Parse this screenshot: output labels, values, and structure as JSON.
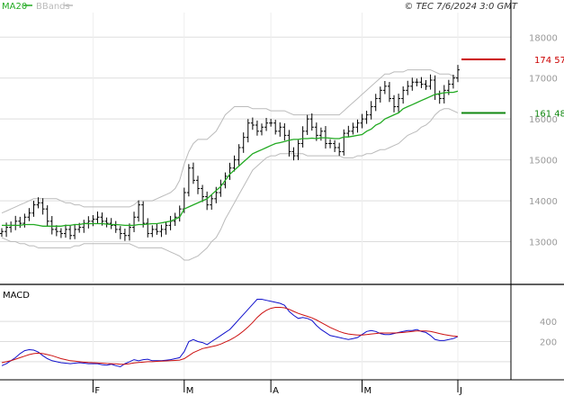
{
  "header": {
    "legend": [
      {
        "name": "MA20",
        "color": "#22aa22"
      },
      {
        "name": "BBands",
        "color": "#bbbbbb"
      }
    ],
    "source": "© TEC 7/6/2024 3:0 GMT"
  },
  "colors": {
    "candle": "#000000",
    "ma20": "#22aa22",
    "bbands": "#bbbbbb",
    "resistance": "#cc0000",
    "support": "#118811",
    "macd": "#1111cc",
    "signal": "#cc1111",
    "grid": "#dddddd",
    "axis_text": "#999999"
  },
  "chart_data": [
    {
      "type": "candlestick",
      "title": "",
      "ylim": [
        12000,
        18600
      ],
      "yticks": [
        {
          "value": 13000,
          "label": "13000"
        },
        {
          "value": 14000,
          "label": "14000"
        },
        {
          "value": 15000,
          "label": "15000"
        },
        {
          "value": 16000,
          "label": "16000"
        },
        {
          "value": 17000,
          "label": "17000"
        },
        {
          "value": 18000,
          "label": "18000"
        }
      ],
      "levels": [
        {
          "name": "resistance",
          "value": 17457,
          "label": "174 57",
          "color": "#cc0000"
        },
        {
          "name": "support",
          "value": 16148,
          "label": "161 48",
          "color": "#118811"
        }
      ],
      "x_months": [
        {
          "label": "F",
          "index": 20
        },
        {
          "label": "M",
          "index": 40
        },
        {
          "label": "A",
          "index": 59
        },
        {
          "label": "M",
          "index": 79
        },
        {
          "label": "J",
          "index": 100
        }
      ],
      "close": [
        13250,
        13350,
        13400,
        13500,
        13450,
        13600,
        13700,
        13900,
        13950,
        13800,
        13500,
        13300,
        13250,
        13200,
        13300,
        13150,
        13300,
        13350,
        13450,
        13500,
        13550,
        13600,
        13500,
        13450,
        13400,
        13300,
        13200,
        13150,
        13350,
        13600,
        13900,
        13450,
        13200,
        13300,
        13250,
        13300,
        13400,
        13500,
        13600,
        13800,
        14200,
        14800,
        14500,
        14300,
        14100,
        13900,
        14050,
        14200,
        14400,
        14600,
        14800,
        15000,
        15300,
        15550,
        15900,
        15850,
        15700,
        15800,
        15900,
        15900,
        15700,
        15800,
        15600,
        15200,
        15100,
        15400,
        15700,
        16000,
        15800,
        15600,
        15700,
        15400,
        15400,
        15300,
        15200,
        15650,
        15700,
        15800,
        15900,
        16000,
        16100,
        16300,
        16500,
        16700,
        16800,
        16500,
        16300,
        16500,
        16700,
        16800,
        16900,
        16900,
        16850,
        16800,
        16950,
        16600,
        16500,
        16700,
        16850,
        17000,
        17200
      ],
      "ma20": [
        13400,
        13400,
        13400,
        13400,
        13400,
        13420,
        13420,
        13420,
        13400,
        13380,
        13380,
        13380,
        13380,
        13380,
        13400,
        13400,
        13420,
        13420,
        13440,
        13440,
        13440,
        13440,
        13440,
        13430,
        13420,
        13420,
        13410,
        13400,
        13400,
        13400,
        13420,
        13420,
        13430,
        13440,
        13440,
        13460,
        13480,
        13500,
        13550,
        13600,
        13800,
        13850,
        13900,
        13950,
        14000,
        14050,
        14150,
        14250,
        14350,
        14500,
        14650,
        14750,
        14850,
        14950,
        15050,
        15150,
        15200,
        15250,
        15300,
        15350,
        15400,
        15420,
        15450,
        15480,
        15500,
        15500,
        15520,
        15520,
        15530,
        15520,
        15540,
        15540,
        15530,
        15520,
        15520,
        15560,
        15560,
        15580,
        15600,
        15620,
        15700,
        15750,
        15850,
        15900,
        16000,
        16050,
        16100,
        16150,
        16250,
        16300,
        16350,
        16400,
        16450,
        16500,
        16550,
        16600,
        16620,
        16640,
        16650,
        16650,
        16680
      ],
      "bb_upper": [
        13700,
        13750,
        13800,
        13850,
        13900,
        13950,
        14000,
        14050,
        14050,
        14050,
        14050,
        14050,
        14050,
        14000,
        13950,
        13950,
        13900,
        13900,
        13850,
        13850,
        13850,
        13850,
        13850,
        13850,
        13850,
        13850,
        13850,
        13850,
        13850,
        13900,
        14000,
        14000,
        14000,
        14000,
        14050,
        14100,
        14150,
        14200,
        14300,
        14500,
        14900,
        15200,
        15400,
        15500,
        15500,
        15500,
        15600,
        15700,
        15900,
        16100,
        16200,
        16300,
        16300,
        16300,
        16300,
        16250,
        16250,
        16250,
        16250,
        16200,
        16200,
        16200,
        16200,
        16150,
        16100,
        16100,
        16100,
        16100,
        16100,
        16100,
        16100,
        16100,
        16100,
        16100,
        16100,
        16200,
        16300,
        16400,
        16500,
        16600,
        16700,
        16800,
        16900,
        17000,
        17100,
        17100,
        17150,
        17150,
        17150,
        17200,
        17200,
        17200,
        17200,
        17200,
        17200,
        17150,
        17100,
        17100,
        17100,
        17050,
        17000
      ],
      "bb_lower": [
        13100,
        13050,
        13000,
        13000,
        12950,
        12950,
        12900,
        12900,
        12850,
        12850,
        12850,
        12850,
        12850,
        12850,
        12850,
        12850,
        12900,
        12900,
        12950,
        12950,
        12950,
        12950,
        12950,
        12950,
        12950,
        12950,
        12950,
        12950,
        12950,
        12900,
        12850,
        12850,
        12850,
        12850,
        12850,
        12850,
        12800,
        12750,
        12700,
        12650,
        12550,
        12550,
        12600,
        12650,
        12750,
        12850,
        13000,
        13100,
        13300,
        13550,
        13750,
        13950,
        14150,
        14350,
        14550,
        14750,
        14850,
        14950,
        15050,
        15100,
        15100,
        15150,
        15150,
        15150,
        15150,
        15150,
        15150,
        15100,
        15100,
        15100,
        15100,
        15100,
        15100,
        15100,
        15100,
        15050,
        15050,
        15050,
        15100,
        15100,
        15150,
        15150,
        15200,
        15250,
        15250,
        15300,
        15350,
        15400,
        15500,
        15600,
        15650,
        15700,
        15800,
        15850,
        15950,
        16100,
        16200,
        16250,
        16250,
        16200,
        16150
      ]
    },
    {
      "type": "line",
      "title": "MACD",
      "ylim": [
        -180,
        750
      ],
      "yticks": [
        {
          "value": 200,
          "label": "200"
        },
        {
          "value": 400,
          "label": "400"
        }
      ],
      "series": [
        {
          "name": "macd",
          "color": "#1111cc",
          "values": [
            -40,
            -20,
            10,
            40,
            80,
            110,
            120,
            115,
            95,
            60,
            30,
            10,
            0,
            -10,
            -15,
            -20,
            -15,
            -10,
            -15,
            -20,
            -20,
            -20,
            -30,
            -35,
            -25,
            -40,
            -50,
            -20,
            0,
            20,
            10,
            20,
            25,
            10,
            10,
            10,
            15,
            20,
            30,
            40,
            100,
            200,
            220,
            200,
            190,
            170,
            200,
            230,
            260,
            290,
            320,
            370,
            420,
            470,
            520,
            570,
            620,
            620,
            610,
            600,
            590,
            580,
            560,
            500,
            460,
            430,
            440,
            430,
            410,
            360,
            320,
            290,
            260,
            250,
            240,
            230,
            220,
            230,
            240,
            270,
            300,
            310,
            300,
            280,
            270,
            270,
            280,
            290,
            300,
            310,
            310,
            320,
            300,
            290,
            260,
            220,
            210,
            210,
            220,
            230,
            250
          ]
        },
        {
          "name": "signal",
          "color": "#cc1111",
          "values": [
            -10,
            0,
            10,
            25,
            40,
            55,
            70,
            80,
            85,
            80,
            70,
            60,
            45,
            30,
            20,
            10,
            5,
            0,
            -5,
            -8,
            -10,
            -12,
            -15,
            -18,
            -20,
            -22,
            -26,
            -25,
            -20,
            -12,
            -8,
            -5,
            0,
            0,
            3,
            5,
            8,
            10,
            12,
            16,
            30,
            60,
            90,
            110,
            130,
            140,
            150,
            160,
            175,
            195,
            215,
            240,
            270,
            305,
            345,
            390,
            440,
            480,
            510,
            530,
            540,
            540,
            535,
            520,
            500,
            480,
            465,
            450,
            435,
            415,
            390,
            365,
            340,
            320,
            300,
            285,
            275,
            270,
            265,
            265,
            270,
            275,
            280,
            285,
            285,
            285,
            285,
            287,
            290,
            295,
            300,
            305,
            306,
            305,
            300,
            290,
            280,
            270,
            262,
            255,
            250
          ]
        }
      ]
    }
  ]
}
